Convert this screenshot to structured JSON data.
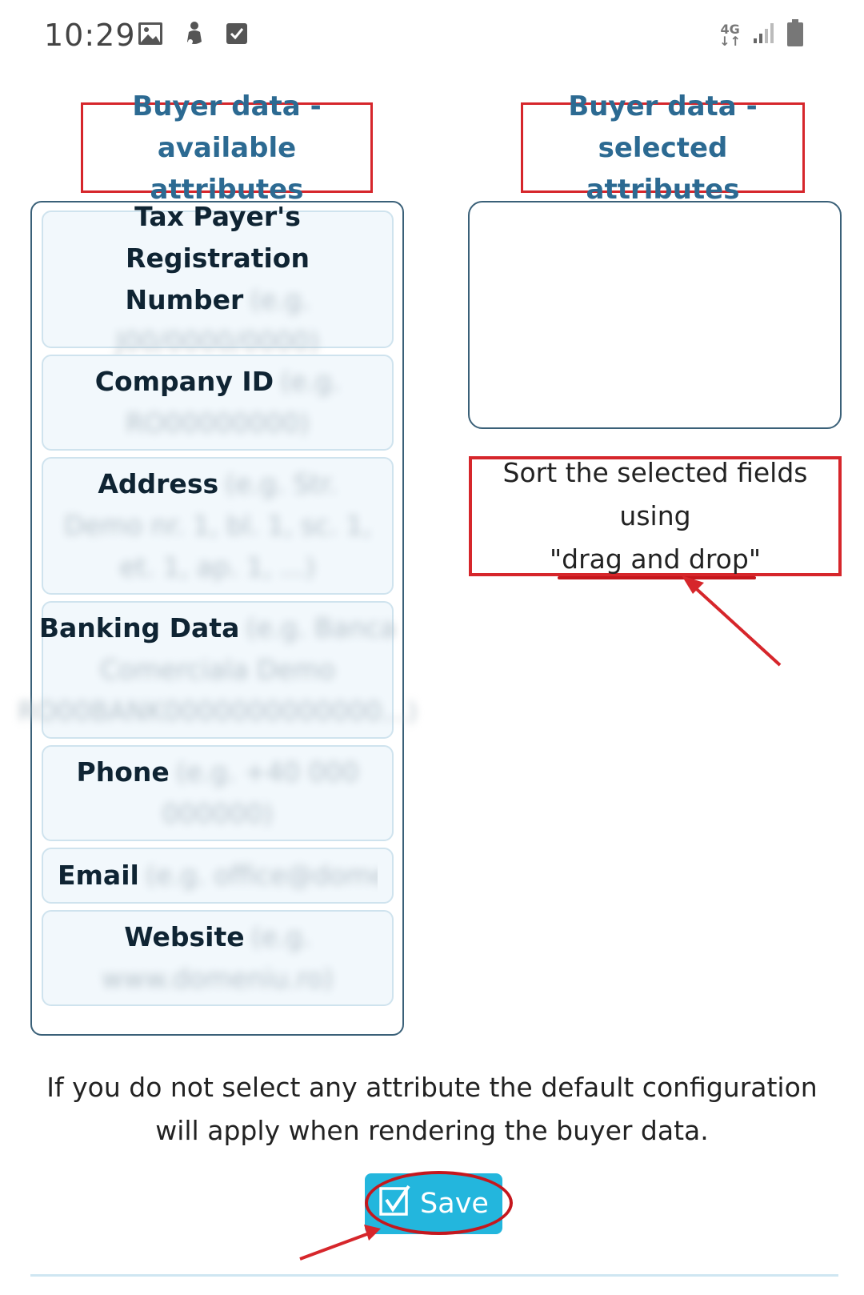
{
  "status_bar": {
    "time": "10:29",
    "network": "4G",
    "left_icons": [
      "image-icon",
      "figure-icon",
      "checkbox-icon"
    ],
    "right_icons": [
      "network-4g-icon",
      "signal-icon",
      "battery-icon"
    ]
  },
  "available": {
    "title": "Buyer data - available attributes",
    "items": [
      {
        "label": "Tax Payer's Registration Number",
        "hint": "(e.g. J00/0000/0000)"
      },
      {
        "label": "Company ID",
        "hint": "(e.g. RO00000000)"
      },
      {
        "label": "Address",
        "hint": "(e.g. Str. Demo nr. 1, bl. 1, sc. 1, et. 1, ap. 1, ...)"
      },
      {
        "label": "Banking Data",
        "hint": "(e.g. Banca Comerciala Demo RO00BANK0000000000000...)"
      },
      {
        "label": "Phone",
        "hint": "(e.g. +40 000 000000)"
      },
      {
        "label": "Email",
        "hint": "(e.g. office@domeniu.ro)"
      },
      {
        "label": "Website",
        "hint": "(e.g. www.domeniu.ro)"
      }
    ]
  },
  "selected": {
    "title": "Buyer data - selected attributes",
    "items": []
  },
  "sort_hint": {
    "line1": "Sort the selected fields using",
    "line2": "\"drag and drop\""
  },
  "note": "If you do not select any attribute the default configuration will apply when rendering the buyer data.",
  "save_button": {
    "label": "Save",
    "icon": "checkbox-check-icon"
  },
  "colors": {
    "title_blue": "#2c6a92",
    "panel_border": "#3a6078",
    "card_bg": "#f2f8fc",
    "card_border": "#cfe3ee",
    "save_bg": "#23b6dd",
    "annotation_red": "#d6262b"
  }
}
